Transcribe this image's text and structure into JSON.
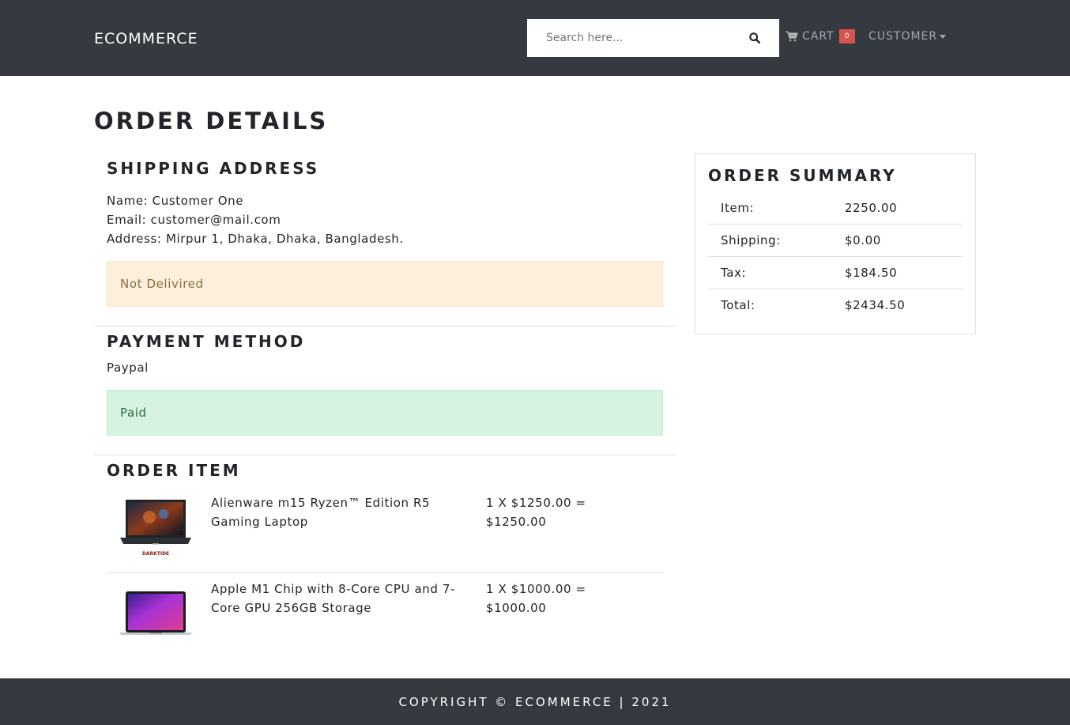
{
  "navbar": {
    "brand": "ECOMMERCE",
    "search_placeholder": "Search here...",
    "search_button_icon": "search-icon",
    "cart_label": "CART",
    "cart_icon": "shopping-cart-icon",
    "cart_count": "0",
    "customer_label": "CUSTOMER"
  },
  "page": {
    "title": "ORDER DETAILS"
  },
  "shipping": {
    "title": "SHIPPING ADDRESS",
    "name_line": "Name: Customer One",
    "email_line": "Email: customer@mail.com",
    "address_line": "Address: Mirpur 1, Dhaka, Dhaka, Bangladesh.",
    "delivery_status": "Not Delivired"
  },
  "payment": {
    "title": "PAYMENT METHOD",
    "method": "Paypal",
    "status": "Paid"
  },
  "order_items": {
    "title": "ORDER ITEM",
    "items": [
      {
        "name": "Alienware m15 Ryzen™ Edition R5 Gaming Laptop",
        "price_line": "1 X $1250.00 = $1250.00",
        "thumb_caption": "DARKTIDE"
      },
      {
        "name": "Apple M1 Chip with 8-Core CPU and 7-Core GPU 256GB Storage",
        "price_line": "1 X $1000.00 = $1000.00"
      }
    ]
  },
  "summary": {
    "title": "ORDER SUMMARY",
    "rows": [
      {
        "label": "Item:",
        "value": "2250.00"
      },
      {
        "label": "Shipping:",
        "value": "$0.00"
      },
      {
        "label": "Tax:",
        "value": "$184.50"
      },
      {
        "label": "Total:",
        "value": "$2434.50"
      }
    ]
  },
  "footer": {
    "text": "COPYRIGHT © ECOMMERCE | 2021"
  },
  "colors": {
    "navbar_bg": "#343a40",
    "warning_bg": "#fcefdc",
    "success_bg": "#d6f3e0",
    "badge_bg": "#d9534f"
  }
}
